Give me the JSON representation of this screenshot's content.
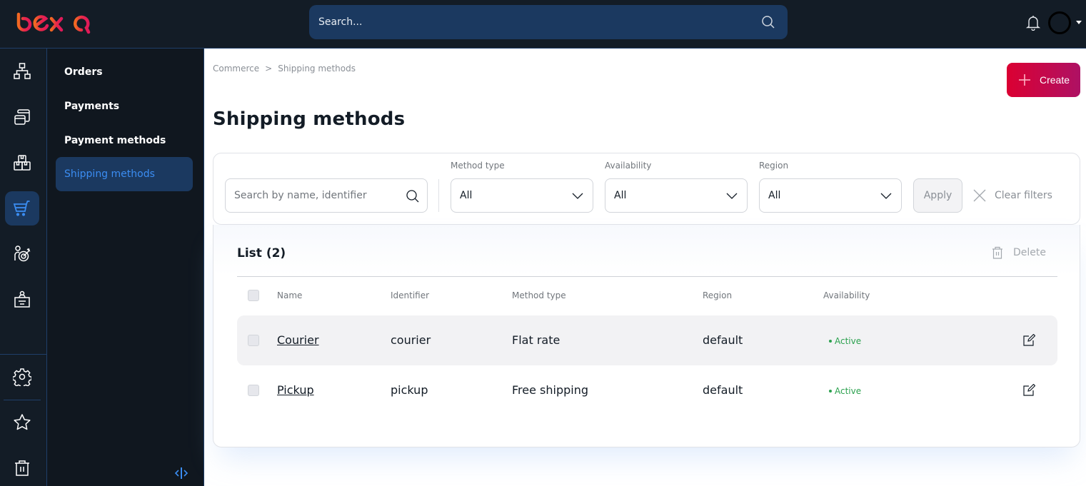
{
  "app": {
    "logo_text": "ibexa",
    "colors": {
      "topbar": "#131c26",
      "accent": "#3b8df2",
      "brand_gradient_start": "#db0032",
      "brand_gradient_end": "#ae1164",
      "active_green": "#2ba14e"
    }
  },
  "topbar": {
    "search_placeholder": "Search...",
    "icons": [
      "search-icon",
      "bell-icon",
      "avatar",
      "caret-down-icon"
    ]
  },
  "rail": {
    "items": [
      {
        "name": "content-structure",
        "icon": "sitemap-icon",
        "active": false
      },
      {
        "name": "forms",
        "icon": "cards-icon",
        "active": false
      },
      {
        "name": "catalog",
        "icon": "boxes-icon",
        "active": false
      },
      {
        "name": "commerce",
        "icon": "cart-icon",
        "active": true
      },
      {
        "name": "customer-portal",
        "icon": "user-target-icon",
        "active": false
      },
      {
        "name": "admin",
        "icon": "briefcase-user-icon",
        "active": false
      }
    ],
    "bottom_items": [
      {
        "name": "settings",
        "icon": "gear-icon"
      },
      {
        "name": "bookmarks",
        "icon": "star-icon"
      },
      {
        "name": "trash",
        "icon": "trash-icon"
      }
    ]
  },
  "subnav": {
    "items": [
      {
        "label": "Orders",
        "active": false
      },
      {
        "label": "Payments",
        "active": false
      },
      {
        "label": "Payment methods",
        "active": false
      },
      {
        "label": "Shipping methods",
        "active": true
      }
    ]
  },
  "breadcrumb": {
    "items": [
      "Commerce",
      "Shipping methods"
    ],
    "separator": ">"
  },
  "page": {
    "title": "Shipping methods",
    "create_label": "Create"
  },
  "filters": {
    "search_placeholder": "Search by name, identifier",
    "selects": [
      {
        "label": "Method type",
        "value": "All"
      },
      {
        "label": "Availability",
        "value": "All"
      },
      {
        "label": "Region",
        "value": "All"
      }
    ],
    "apply_label": "Apply",
    "clear_label": "Clear filters"
  },
  "list": {
    "title": "List (2)",
    "delete_label": "Delete",
    "columns": [
      "Name",
      "Identifier",
      "Method type",
      "Region",
      "Availability"
    ],
    "rows": [
      {
        "name": "Courier",
        "identifier": "courier",
        "method_type": "Flat rate",
        "region": "default",
        "availability": "Active"
      },
      {
        "name": "Pickup",
        "identifier": "pickup",
        "method_type": "Free shipping",
        "region": "default",
        "availability": "Active"
      }
    ]
  }
}
